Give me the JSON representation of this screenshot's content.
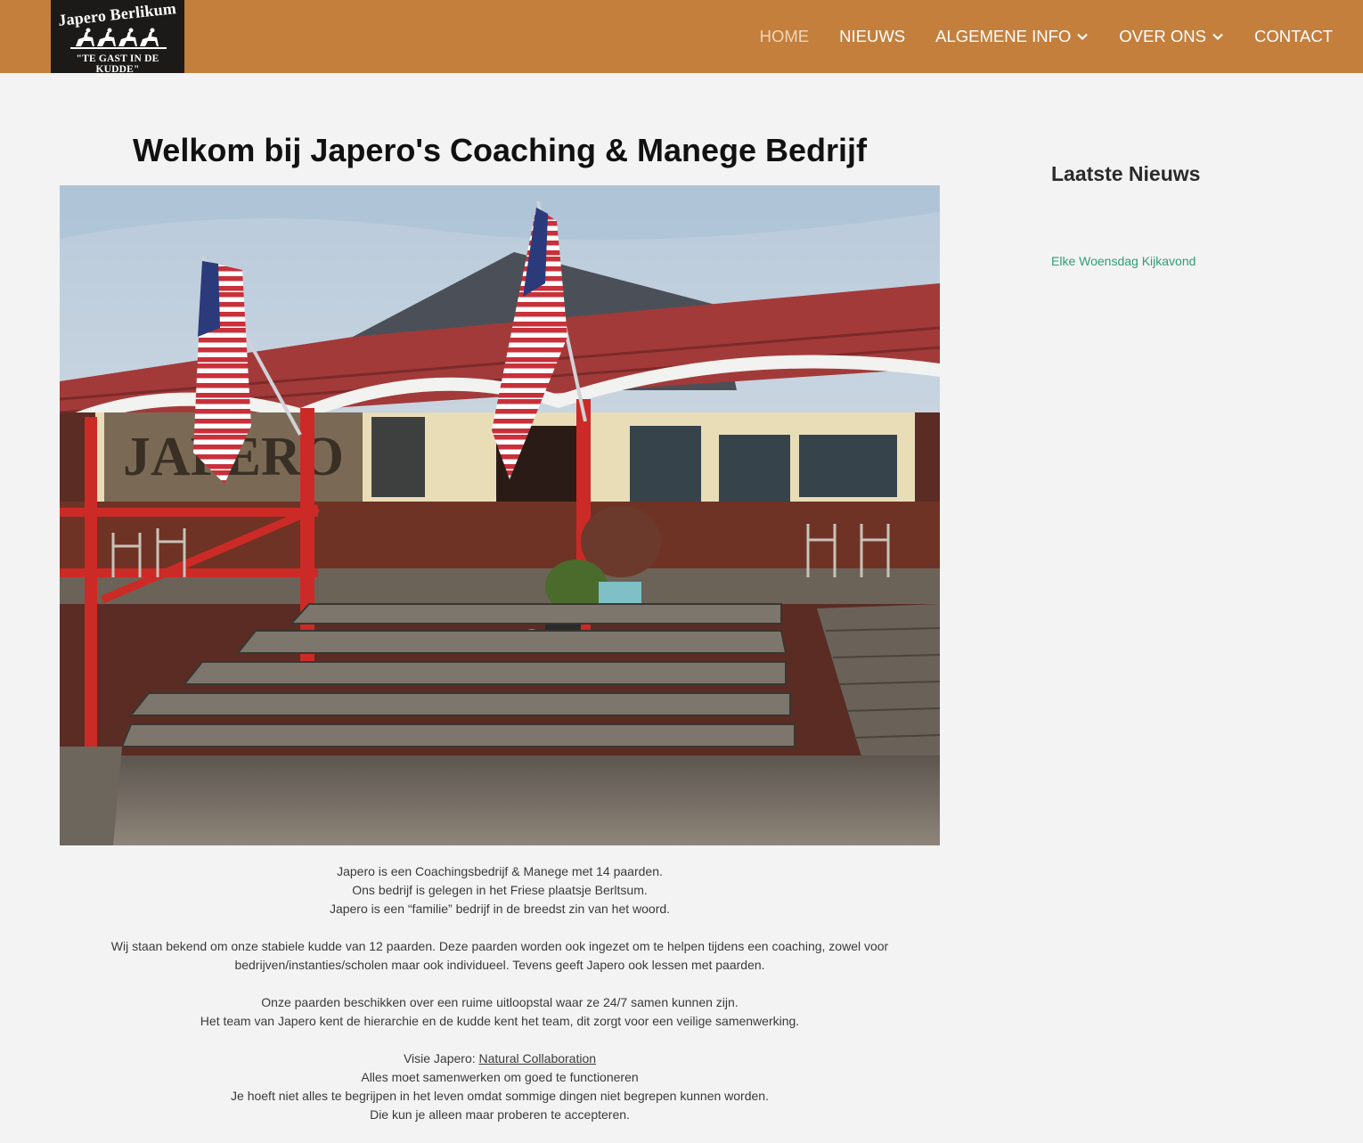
{
  "header": {
    "logo": {
      "line1": "Japero Berlikum",
      "line2": "\"TE GAST IN DE KUDDE\""
    },
    "nav": [
      {
        "label": "HOME",
        "active": true,
        "dropdown": false
      },
      {
        "label": "NIEUWS",
        "active": false,
        "dropdown": false
      },
      {
        "label": "ALGEMENE INFO",
        "active": false,
        "dropdown": true
      },
      {
        "label": "OVER ONS",
        "active": false,
        "dropdown": true
      },
      {
        "label": "CONTACT",
        "active": false,
        "dropdown": false
      }
    ],
    "colors": {
      "bar": "#c47f3d",
      "active": "#f0d6b8"
    }
  },
  "main": {
    "title": "Welkom bij Japero's Coaching & Manege Bedrijf",
    "hero_image_sign": "JAPERO",
    "paragraphs": [
      [
        "Japero is een Coachingsbedrijf & Manege met 14 paarden.",
        "Ons bedrijf is gelegen in het Friese plaatsje Berltsum.",
        "Japero is een “familie” bedrijf in de breedst zin van het woord."
      ],
      [
        "Wij staan bekend om onze stabiele kudde van 12 paarden. Deze paarden worden ook ingezet om te helpen tijdens een coaching, zowel voor",
        "bedrijven/instanties/scholen maar ook individueel. Tevens geeft Japero ook lessen met paarden."
      ],
      [
        "Onze paarden beschikken over een ruime uitloopstal waar ze 24/7 samen kunnen zijn.",
        "Het team van Japero kent de hierarchie en de kudde kent het team, dit zorgt voor een veilige samenwerking."
      ]
    ],
    "vision": {
      "prefix": "Visie Japero: ",
      "link": "Natural Collaboration",
      "lines": [
        "Alles moet samenwerken om goed te functioneren",
        "Je hoeft niet alles te begrijpen in het leven omdat sommige dingen niet begrepen kunnen worden.",
        "Die kun je alleen maar proberen te accepteren."
      ]
    }
  },
  "sidebar": {
    "heading": "Laatste Nieuws",
    "items": [
      {
        "label": "Elke Woensdag Kijkavond"
      }
    ],
    "link_color": "#2e9e77"
  },
  "icons": {
    "dropdown": "chevron-down-icon",
    "logo": "horses-logo-icon"
  }
}
